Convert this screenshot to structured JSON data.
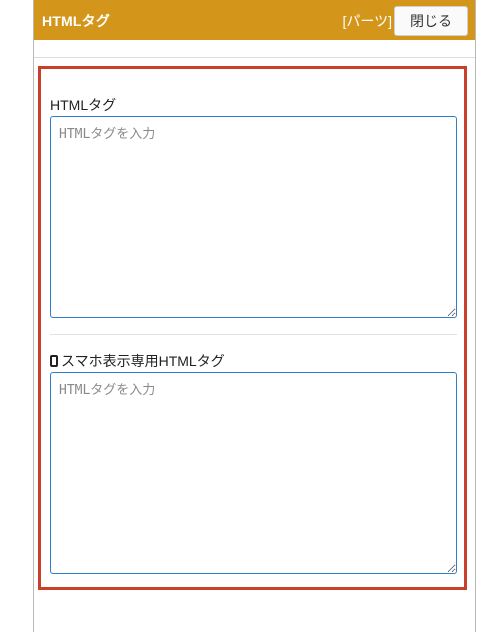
{
  "header": {
    "title": "HTMLタグ",
    "parts_label": "[パーツ]",
    "close_label": "閉じる",
    "background_color": "#d4961a"
  },
  "form": {
    "html_tag": {
      "label": "HTMLタグ",
      "placeholder": "HTMLタグを入力",
      "value": ""
    },
    "sp_html_tag": {
      "icon": "smartphone-icon",
      "label": "スマホ表示専用HTMLタグ",
      "placeholder": "HTMLタグを入力",
      "value": ""
    }
  },
  "highlight_color": "#c8402a"
}
